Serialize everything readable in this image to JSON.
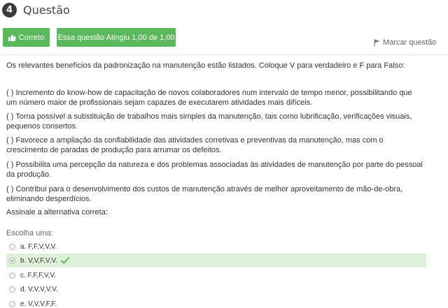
{
  "question": {
    "number": "4",
    "title": "Questão"
  },
  "status": {
    "correct_label": "Correto",
    "score_label": "Essa questão Atingiu 1,00 de 1,00",
    "correct_icon": "thumbs-up-icon",
    "color": "#5cb85c"
  },
  "flag": {
    "label": "Marcar questão",
    "icon": "flag-icon"
  },
  "body": {
    "prompt": "Os relevantes benefícios da padronização na manutenção estão listados. Coloque V para verdadeiro e F para Falso:",
    "statements": [
      "( ) Incremento do know-how de capacitação de novos colaboradores num intervalo de tempo menor, possibilitando que um número maior de profissionais sejam capazes de executarem atividades mais difíceis.",
      "( ) Torna possível a substituição de trabalhos mais simples da manutenção, tais como lubrificação, verificações visuais, pequenos consertos.",
      "( ) Favorece a ampliação da confiabilidade das atividades corretivas e preventivas da manutenção, mas com o crescimento de paradas de produção para arrumar os defeitos.",
      "( ) Possibilita uma percepção da natureza e dos problemas associadas às atividades de manutenção por parte do pessoal da produção.",
      "( ) Contribui para o desenvolvimento dos custos de manutenção através de melhor aproveitamento de mão-de-obra, eliminando desperdícios."
    ],
    "instruction": "Assinale a alternativa correta:"
  },
  "answers": {
    "choose_label": "Escolha uma:",
    "options": [
      {
        "label": "a. F,F,V,V,V."
      },
      {
        "label": "b. V,V,F,V,V."
      },
      {
        "label": "c. F,F,F,V,V."
      },
      {
        "label": "d. V,V,V,V,V."
      },
      {
        "label": "e. V,V,V,F,F."
      }
    ],
    "selected_index": 1,
    "highlight_color": "#dff0d8",
    "check_icon": "checkmark-icon"
  }
}
